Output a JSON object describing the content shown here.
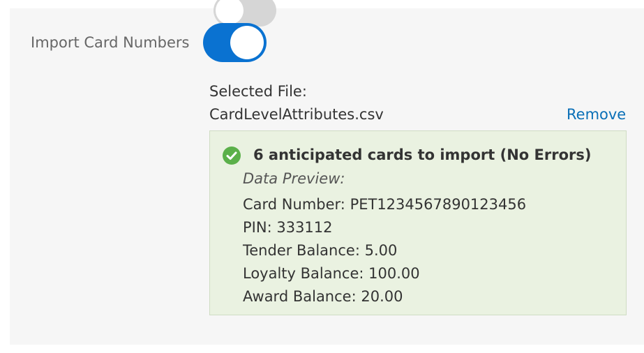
{
  "import_toggle": {
    "label": "Import Card Numbers",
    "state": "on",
    "accent_color": "#0a72d1"
  },
  "selected_file": {
    "label": "Selected File:",
    "file_name": "CardLevelAttributes.csv",
    "remove_label": "Remove"
  },
  "import_result": {
    "status_icon": "check-circle-icon",
    "status_color": "#5bb04a",
    "summary": "6 anticipated cards to import (No Errors)",
    "preview_title": "Data Preview:",
    "preview_rows": [
      {
        "label": "Card Number",
        "value": "PET1234567890123456"
      },
      {
        "label": "PIN",
        "value": "333112"
      },
      {
        "label": "Tender Balance",
        "value": "5.00"
      },
      {
        "label": "Loyalty Balance",
        "value": "100.00"
      },
      {
        "label": "Award Balance",
        "value": "20.00"
      }
    ]
  }
}
